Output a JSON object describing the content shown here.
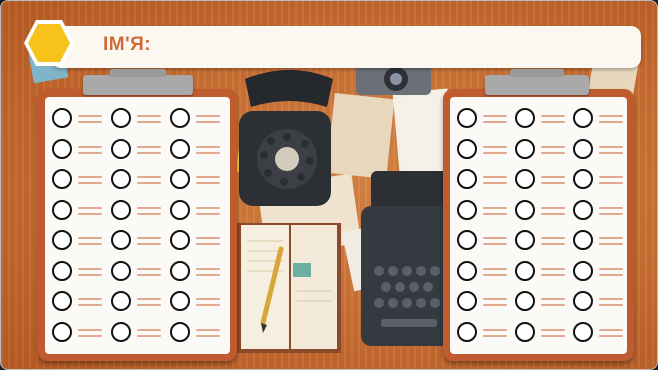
{
  "sheet": {
    "name_label": "ІМ'Я:",
    "badge_color": "#f7c21a",
    "accent": "#d06a3a",
    "clipboard_color": "#c05a2f",
    "columns_per_clipboard": 3,
    "rows_per_clipboard": 8
  },
  "icons": {
    "badge": "hexagon-icon",
    "clip": "clipboard-clip-icon",
    "slot": "circle-checkbox-icon",
    "note_line": "double-line-icon"
  },
  "illustration": {
    "objects": [
      "rotary-telephone-icon",
      "typewriter-icon",
      "open-notebook-icon",
      "pencil-icon",
      "camera-icon",
      "scattered-papers-icon"
    ]
  }
}
